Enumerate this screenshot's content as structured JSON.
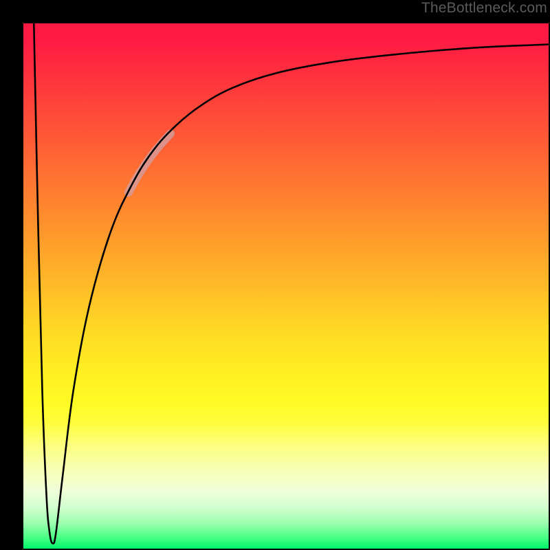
{
  "watermark": "TheBottleneck.com",
  "chart_data": {
    "type": "line",
    "title": "",
    "xlabel": "",
    "ylabel": "",
    "x_range": [
      0,
      100
    ],
    "y_range": [
      0,
      100
    ],
    "grid": false,
    "legend": false,
    "series": [
      {
        "name": "bottleneck-curve-main",
        "color": "#000000",
        "stroke_width": 2.6,
        "points": [
          {
            "x": 2.0,
            "y": 100.0
          },
          {
            "x": 2.8,
            "y": 62.0
          },
          {
            "x": 3.6,
            "y": 30.0
          },
          {
            "x": 4.4,
            "y": 10.0
          },
          {
            "x": 5.0,
            "y": 3.0
          },
          {
            "x": 5.6,
            "y": 1.0
          },
          {
            "x": 6.2,
            "y": 3.0
          },
          {
            "x": 7.5,
            "y": 14.0
          },
          {
            "x": 9.5,
            "y": 30.0
          },
          {
            "x": 12.5,
            "y": 46.0
          },
          {
            "x": 16.5,
            "y": 60.0
          },
          {
            "x": 20.5,
            "y": 69.0
          },
          {
            "x": 24.5,
            "y": 75.5
          },
          {
            "x": 29.0,
            "y": 80.5
          },
          {
            "x": 34.0,
            "y": 84.5
          },
          {
            "x": 40.0,
            "y": 87.8
          },
          {
            "x": 48.0,
            "y": 90.5
          },
          {
            "x": 58.0,
            "y": 92.5
          },
          {
            "x": 70.0,
            "y": 94.0
          },
          {
            "x": 85.0,
            "y": 95.3
          },
          {
            "x": 100.0,
            "y": 96.0
          }
        ]
      },
      {
        "name": "highlight-band",
        "color": "#d69a99",
        "stroke_width": 12,
        "opacity": 0.85,
        "points": [
          {
            "x": 20.0,
            "y": 67.8
          },
          {
            "x": 22.0,
            "y": 71.3
          },
          {
            "x": 24.0,
            "y": 74.3
          },
          {
            "x": 26.0,
            "y": 76.8
          },
          {
            "x": 28.0,
            "y": 79.0
          }
        ]
      }
    ],
    "background": {
      "type": "vertical-gradient",
      "stops": [
        {
          "offset": 0.0,
          "color": "#ff1a44"
        },
        {
          "offset": 0.5,
          "color": "#ffcf26"
        },
        {
          "offset": 0.75,
          "color": "#ffff40"
        },
        {
          "offset": 1.0,
          "color": "#00f56a"
        }
      ]
    }
  }
}
